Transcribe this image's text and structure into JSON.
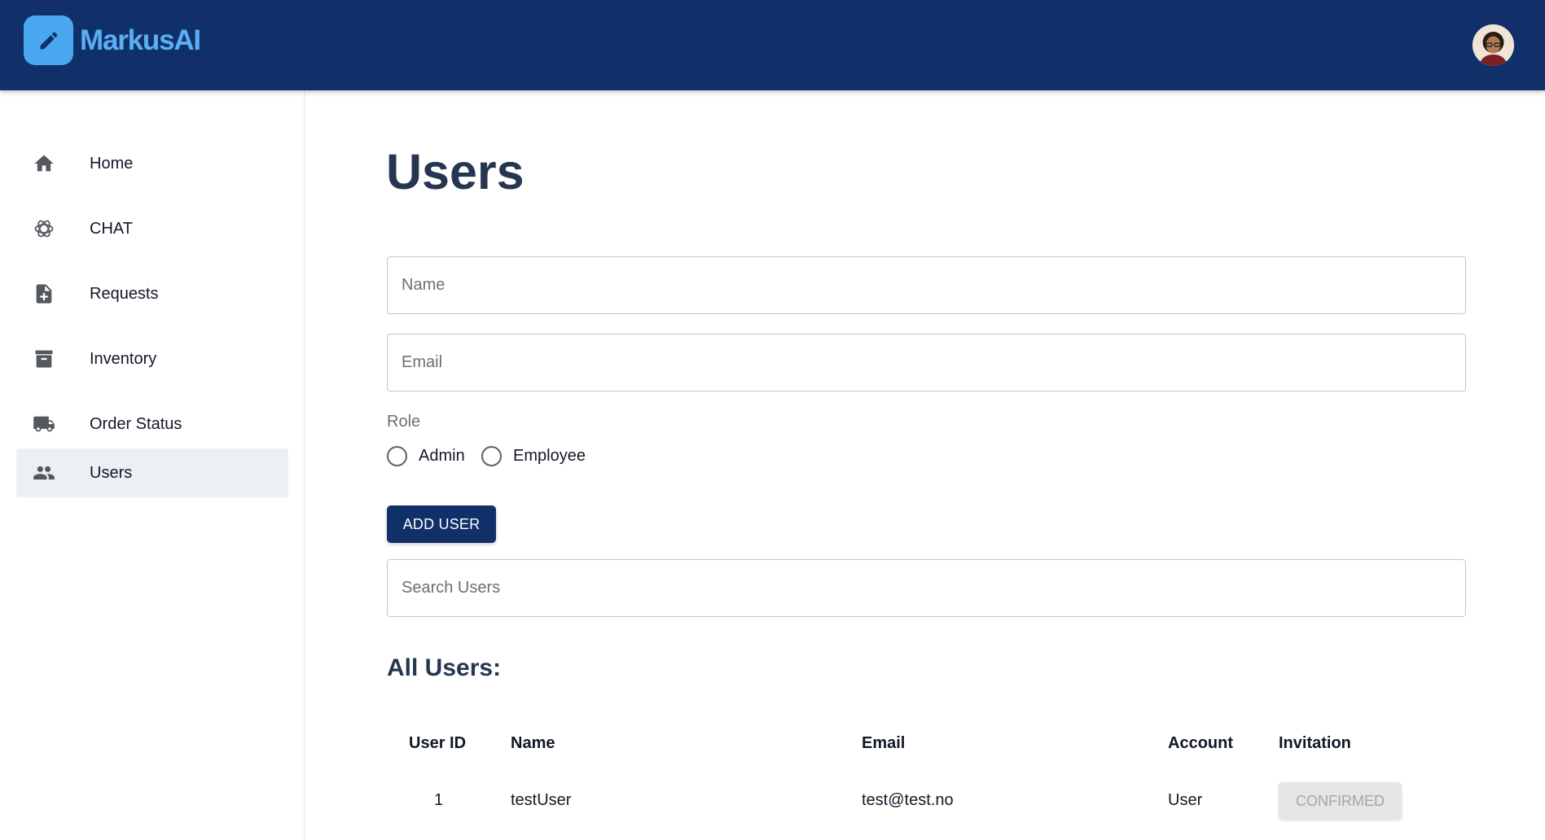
{
  "app": {
    "brand": "MarkusAI"
  },
  "sidebar": {
    "items": [
      {
        "label": "Home",
        "icon": "home-icon"
      },
      {
        "label": "CHAT",
        "icon": "chat-icon"
      },
      {
        "label": "Requests",
        "icon": "request-document-icon"
      },
      {
        "label": "Inventory",
        "icon": "archive-box-icon"
      },
      {
        "label": "Order Status",
        "icon": "truck-icon"
      },
      {
        "label": "Users",
        "icon": "users-icon",
        "active": true
      }
    ]
  },
  "main": {
    "title": "Users",
    "name_placeholder": "Name",
    "email_placeholder": "Email",
    "role_label": "Role",
    "role_options": [
      "Admin",
      "Employee"
    ],
    "add_button": "ADD USER",
    "search_placeholder": "Search Users",
    "section_title": "All Users:"
  },
  "table": {
    "headers": [
      "User ID",
      "Name",
      "Email",
      "Account",
      "Invitation"
    ],
    "rows": [
      {
        "id": "1",
        "name": "testUser",
        "email": "test@test.no",
        "account": "User",
        "invitation": "CONFIRMED"
      }
    ]
  },
  "colors": {
    "header_bg": "#11306a",
    "brand_accent": "#5aaef2",
    "title_text": "#263651",
    "active_nav_bg": "#eceff3"
  }
}
